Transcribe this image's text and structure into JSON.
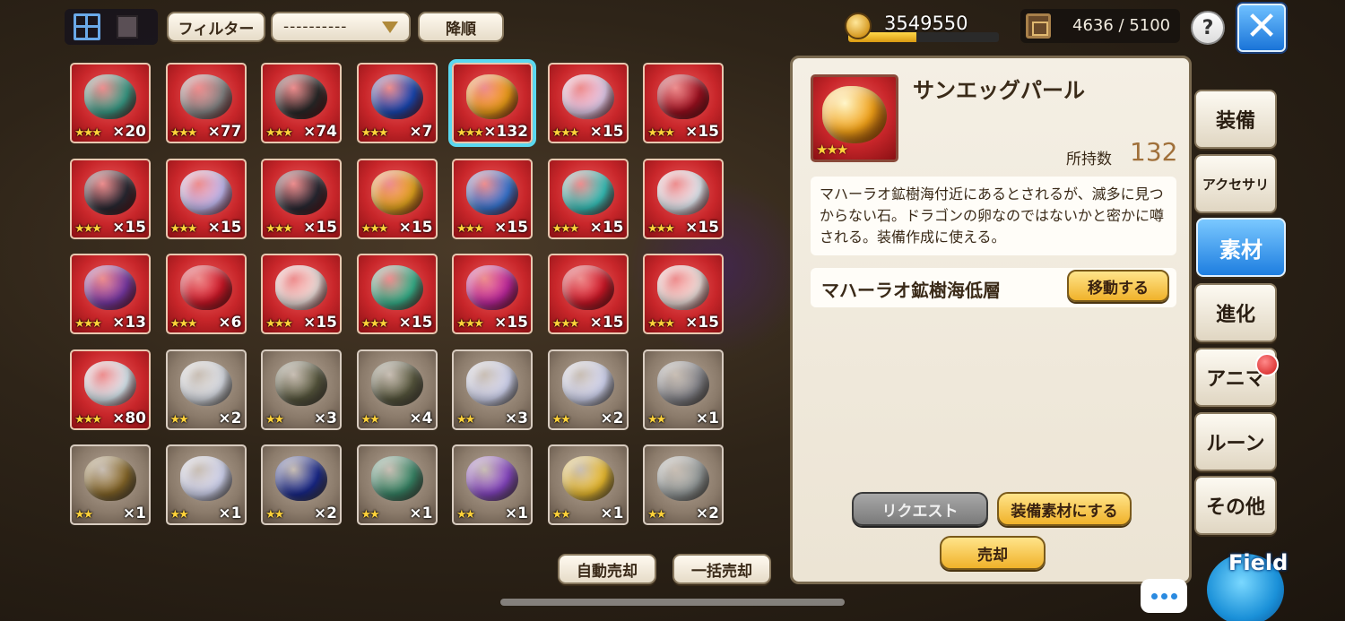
{
  "toolbar": {
    "filter_label": "フィルター",
    "select_value": "----------",
    "sort_label": "降順"
  },
  "currency": {
    "gold": "3549550",
    "gold_fill_fraction": 0.45
  },
  "capacity": {
    "text": "4636 / 5100"
  },
  "help_label": "?",
  "close_label": "✕",
  "items": [
    {
      "stars": "★★★",
      "qty": "×20",
      "rarity": 3,
      "color": "#3aa08a"
    },
    {
      "stars": "★★★",
      "qty": "×77",
      "rarity": 3,
      "color": "#8a8a8a"
    },
    {
      "stars": "★★★",
      "qty": "×74",
      "rarity": 3,
      "color": "#2a2a2a"
    },
    {
      "stars": "★★★",
      "qty": "×7",
      "rarity": 3,
      "color": "#1a4ab8"
    },
    {
      "stars": "★★★",
      "qty": "×132",
      "rarity": 3,
      "color": "#f0a018",
      "selected": true
    },
    {
      "stars": "★★★",
      "qty": "×15",
      "rarity": 3,
      "color": "#e8d0f0"
    },
    {
      "stars": "★★★",
      "qty": "×15",
      "rarity": 3,
      "color": "#a01020"
    },
    {
      "stars": "★★★",
      "qty": "×15",
      "rarity": 3,
      "color": "#2a2a34"
    },
    {
      "stars": "★★★",
      "qty": "×15",
      "rarity": 3,
      "color": "#c8c0f8"
    },
    {
      "stars": "★★★",
      "qty": "×15",
      "rarity": 3,
      "color": "#2a2a34"
    },
    {
      "stars": "★★★",
      "qty": "×15",
      "rarity": 3,
      "color": "#e8a820"
    },
    {
      "stars": "★★★",
      "qty": "×15",
      "rarity": 3,
      "color": "#3a7ad8"
    },
    {
      "stars": "★★★",
      "qty": "×15",
      "rarity": 3,
      "color": "#38c8c0"
    },
    {
      "stars": "★★★",
      "qty": "×15",
      "rarity": 3,
      "color": "#e8f0f8"
    },
    {
      "stars": "★★★",
      "qty": "×13",
      "rarity": 3,
      "color": "#7a3aa8"
    },
    {
      "stars": "★★★",
      "qty": "×6",
      "rarity": 3,
      "color": "#d01828"
    },
    {
      "stars": "★★★",
      "qty": "×15",
      "rarity": 3,
      "color": "#f4e4e0"
    },
    {
      "stars": "★★★",
      "qty": "×15",
      "rarity": 3,
      "color": "#38b890"
    },
    {
      "stars": "★★★",
      "qty": "×15",
      "rarity": 3,
      "color": "#c028a0"
    },
    {
      "stars": "★★★",
      "qty": "×15",
      "rarity": 3,
      "color": "#d01828"
    },
    {
      "stars": "★★★",
      "qty": "×15",
      "rarity": 3,
      "color": "#f4e4e0"
    },
    {
      "stars": "★★★",
      "qty": "×80",
      "rarity": 3,
      "color": "#e0f0f8"
    },
    {
      "stars": "★★",
      "qty": "×2",
      "rarity": 2,
      "color": "#e0e4ec"
    },
    {
      "stars": "★★",
      "qty": "×3",
      "rarity": 2,
      "color": "#5a5a40"
    },
    {
      "stars": "★★",
      "qty": "×4",
      "rarity": 2,
      "color": "#5a5a40"
    },
    {
      "stars": "★★",
      "qty": "×3",
      "rarity": 2,
      "color": "#d8dcf8"
    },
    {
      "stars": "★★",
      "qty": "×2",
      "rarity": 2,
      "color": "#d8dcf8"
    },
    {
      "stars": "★★",
      "qty": "×1",
      "rarity": 2,
      "color": "#8a8a90"
    },
    {
      "stars": "★★",
      "qty": "×1",
      "rarity": 2,
      "color": "#8a6a2a"
    },
    {
      "stars": "★★",
      "qty": "×1",
      "rarity": 2,
      "color": "#d8dcf8"
    },
    {
      "stars": "★★",
      "qty": "×2",
      "rarity": 2,
      "color": "#1a2a90"
    },
    {
      "stars": "★★",
      "qty": "×1",
      "rarity": 2,
      "color": "#3a8a6a"
    },
    {
      "stars": "★★",
      "qty": "×1",
      "rarity": 2,
      "color": "#8a48c8"
    },
    {
      "stars": "★★",
      "qty": "×1",
      "rarity": 2,
      "color": "#f0c030"
    },
    {
      "stars": "★★",
      "qty": "×2",
      "rarity": 2,
      "color": "#9aa0a0"
    }
  ],
  "bottom": {
    "auto_sell": "自動売却",
    "bulk_sell": "一括売却"
  },
  "detail": {
    "name": "サンエッグパール",
    "stars": "★★★",
    "owned_label": "所持数",
    "owned_value": "132",
    "description": "マハーラオ鉱樹海付近にあるとされるが、滅多に見つからない石。ドラゴンの卵なのではないかと密かに噂される。装備作成に使える。",
    "location": "マハーラオ鉱樹海低層",
    "goto_label": "移動する",
    "request_label": "リクエスト",
    "equip_material_label": "装備素材にする",
    "sell_label": "売却",
    "gem_color": "#f0a018"
  },
  "tabs": [
    {
      "label": "装備"
    },
    {
      "label": "アクセサリ"
    },
    {
      "label": "素材",
      "active": true
    },
    {
      "label": "進化"
    },
    {
      "label": "アニマ"
    },
    {
      "label": "ルーン"
    },
    {
      "label": "その他"
    }
  ],
  "field_label": "Field"
}
